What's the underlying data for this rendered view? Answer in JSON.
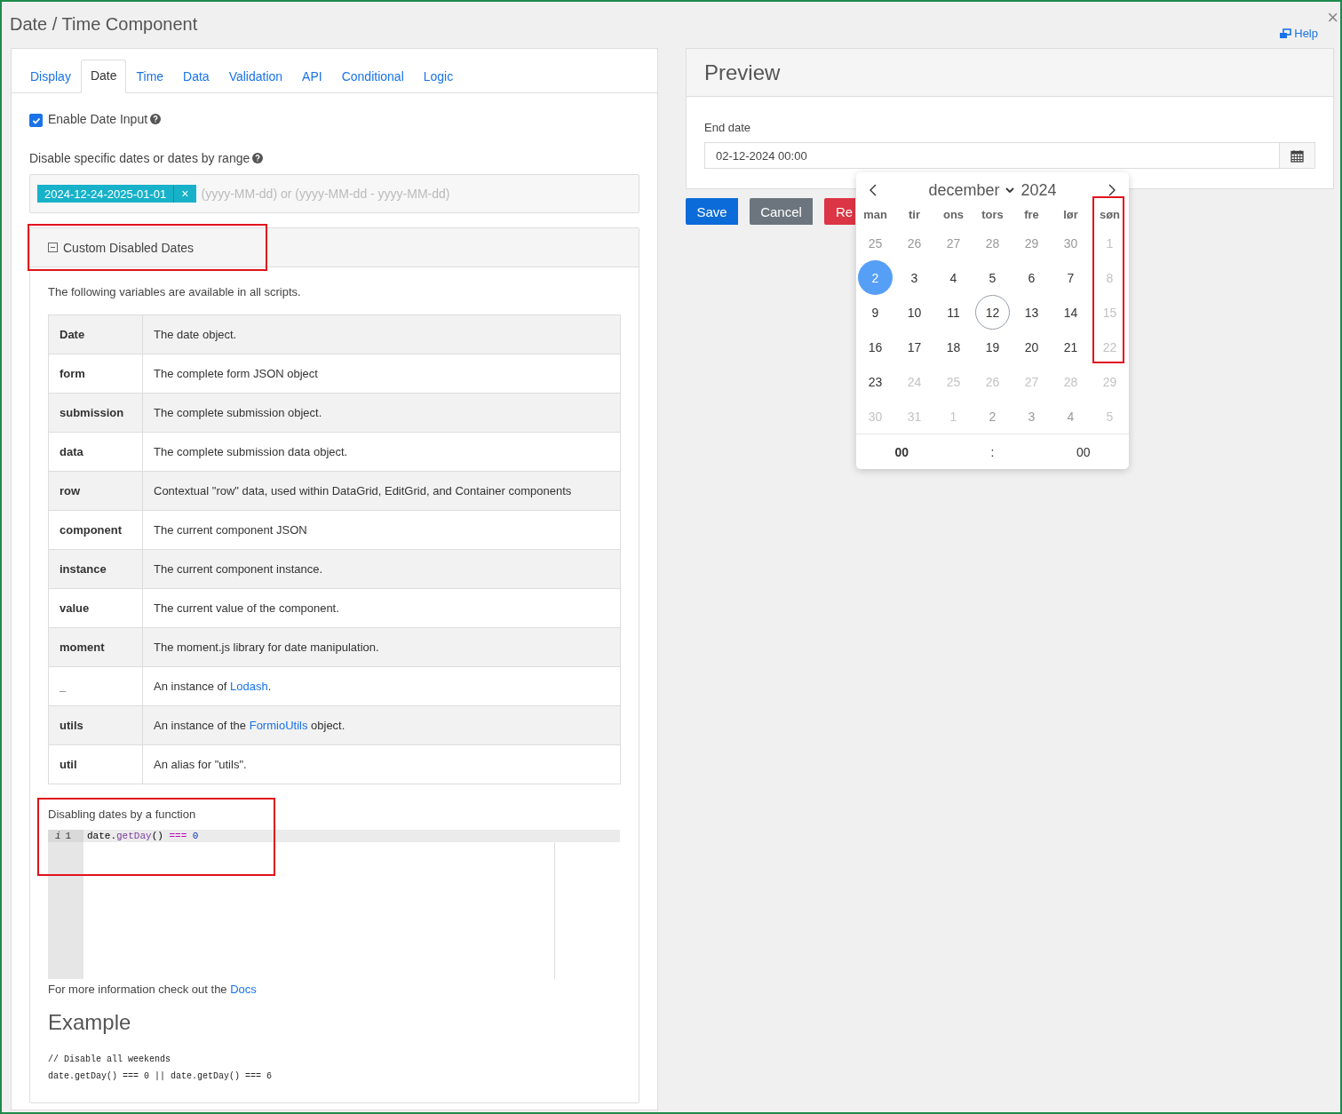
{
  "window": {
    "title": "Date / Time Component",
    "help_link": "Help",
    "close": "×"
  },
  "tabs": [
    {
      "label": "Display",
      "selected": false
    },
    {
      "label": "Date",
      "selected": true
    },
    {
      "label": "Time",
      "selected": false
    },
    {
      "label": "Data",
      "selected": false
    },
    {
      "label": "Validation",
      "selected": false
    },
    {
      "label": "API",
      "selected": false
    },
    {
      "label": "Conditional",
      "selected": false
    },
    {
      "label": "Logic",
      "selected": false
    }
  ],
  "enable_date_input": {
    "label": "Enable Date Input",
    "checked": true
  },
  "disable_dates": {
    "label": "Disable specific dates or dates by range",
    "tags": [
      "2024-12-24-2025-01-01"
    ],
    "tag_remove": "×",
    "placeholder": "(yyyy-MM-dd) or (yyyy-MM-dd - yyyy-MM-dd)"
  },
  "custom_panel": {
    "title": "Custom Disabled Dates",
    "expanded": true,
    "annotated": true,
    "intro": "The following variables are available in all scripts.",
    "variables": [
      {
        "name": "Date",
        "description": "The date object."
      },
      {
        "name": "form",
        "description": "The complete form JSON object"
      },
      {
        "name": "submission",
        "description": "The complete submission object."
      },
      {
        "name": "data",
        "description": "The complete submission data object."
      },
      {
        "name": "row",
        "description": "Contextual \"row\" data, used within DataGrid, EditGrid, and Container components"
      },
      {
        "name": "component",
        "description": "The current component JSON"
      },
      {
        "name": "instance",
        "description": "The current component instance."
      },
      {
        "name": "value",
        "description": "The current value of the component."
      },
      {
        "name": "moment",
        "description": "The moment.js library for date manipulation."
      },
      {
        "name": "_",
        "description": "An instance of ",
        "link": "Lodash",
        "after": "."
      },
      {
        "name": "utils",
        "description": "An instance of the ",
        "link": "FormioUtils",
        "after": " object."
      },
      {
        "name": "util",
        "description": "An alias for \"utils\"."
      }
    ],
    "function_editor": {
      "label": "Disabling dates by a function",
      "annotated": true,
      "lines": [
        {
          "marker": "i",
          "number": "1",
          "tokens": [
            {
              "text": "date.",
              "kind": "plain"
            },
            {
              "text": "getDay",
              "kind": "method"
            },
            {
              "text": "()",
              "kind": "plain"
            },
            {
              "text": " === ",
              "kind": "operator"
            },
            {
              "text": "0",
              "kind": "number"
            }
          ]
        }
      ]
    },
    "docs": {
      "text": "For more information check out the ",
      "link": "Docs"
    },
    "example": {
      "title": "Example",
      "code": [
        "// Disable all weekends",
        "date.getDay() === 0 || date.getDay() === 6"
      ]
    }
  },
  "preview": {
    "title": "Preview",
    "field_label": "End date",
    "value": "02-12-2024 00:00",
    "buttons": [
      {
        "label": "Save",
        "kind": "primary"
      },
      {
        "label": "Cancel",
        "kind": "secondary"
      },
      {
        "label": "Re",
        "kind": "danger"
      }
    ]
  },
  "calendar": {
    "month": "december",
    "year": "2024",
    "weekdays": [
      {
        "label": "man",
        "annotated": false
      },
      {
        "label": "tir",
        "annotated": false
      },
      {
        "label": "ons",
        "annotated": false
      },
      {
        "label": "tors",
        "annotated": false
      },
      {
        "label": "fre",
        "annotated": false
      },
      {
        "label": "lør",
        "annotated": false
      },
      {
        "label": "søn",
        "annotated": true
      }
    ],
    "weeks": [
      [
        {
          "day": "25",
          "outside": true,
          "disabled": false,
          "selected": false,
          "today": false
        },
        {
          "day": "26",
          "outside": true,
          "disabled": false,
          "selected": false,
          "today": false
        },
        {
          "day": "27",
          "outside": true,
          "disabled": false,
          "selected": false,
          "today": false
        },
        {
          "day": "28",
          "outside": true,
          "disabled": false,
          "selected": false,
          "today": false
        },
        {
          "day": "29",
          "outside": true,
          "disabled": false,
          "selected": false,
          "today": false
        },
        {
          "day": "30",
          "outside": true,
          "disabled": false,
          "selected": false,
          "today": false
        },
        {
          "day": "1",
          "outside": false,
          "disabled": true,
          "selected": false,
          "today": false
        }
      ],
      [
        {
          "day": "2",
          "outside": false,
          "disabled": false,
          "selected": true,
          "today": false
        },
        {
          "day": "3",
          "outside": false,
          "disabled": false,
          "selected": false,
          "today": false
        },
        {
          "day": "4",
          "outside": false,
          "disabled": false,
          "selected": false,
          "today": false
        },
        {
          "day": "5",
          "outside": false,
          "disabled": false,
          "selected": false,
          "today": false
        },
        {
          "day": "6",
          "outside": false,
          "disabled": false,
          "selected": false,
          "today": false
        },
        {
          "day": "7",
          "outside": false,
          "disabled": false,
          "selected": false,
          "today": false
        },
        {
          "day": "8",
          "outside": false,
          "disabled": true,
          "selected": false,
          "today": false
        }
      ],
      [
        {
          "day": "9",
          "outside": false,
          "disabled": false,
          "selected": false,
          "today": false
        },
        {
          "day": "10",
          "outside": false,
          "disabled": false,
          "selected": false,
          "today": false
        },
        {
          "day": "11",
          "outside": false,
          "disabled": false,
          "selected": false,
          "today": false
        },
        {
          "day": "12",
          "outside": false,
          "disabled": false,
          "selected": false,
          "today": true
        },
        {
          "day": "13",
          "outside": false,
          "disabled": false,
          "selected": false,
          "today": false
        },
        {
          "day": "14",
          "outside": false,
          "disabled": false,
          "selected": false,
          "today": false
        },
        {
          "day": "15",
          "outside": false,
          "disabled": true,
          "selected": false,
          "today": false
        }
      ],
      [
        {
          "day": "16",
          "outside": false,
          "disabled": false,
          "selected": false,
          "today": false
        },
        {
          "day": "17",
          "outside": false,
          "disabled": false,
          "selected": false,
          "today": false
        },
        {
          "day": "18",
          "outside": false,
          "disabled": false,
          "selected": false,
          "today": false
        },
        {
          "day": "19",
          "outside": false,
          "disabled": false,
          "selected": false,
          "today": false
        },
        {
          "day": "20",
          "outside": false,
          "disabled": false,
          "selected": false,
          "today": false
        },
        {
          "day": "21",
          "outside": false,
          "disabled": false,
          "selected": false,
          "today": false
        },
        {
          "day": "22",
          "outside": false,
          "disabled": true,
          "selected": false,
          "today": false
        }
      ],
      [
        {
          "day": "23",
          "outside": false,
          "disabled": false,
          "selected": false,
          "today": false
        },
        {
          "day": "24",
          "outside": false,
          "disabled": true,
          "selected": false,
          "today": false
        },
        {
          "day": "25",
          "outside": false,
          "disabled": true,
          "selected": false,
          "today": false
        },
        {
          "day": "26",
          "outside": false,
          "disabled": true,
          "selected": false,
          "today": false
        },
        {
          "day": "27",
          "outside": false,
          "disabled": true,
          "selected": false,
          "today": false
        },
        {
          "day": "28",
          "outside": false,
          "disabled": true,
          "selected": false,
          "today": false
        },
        {
          "day": "29",
          "outside": false,
          "disabled": true,
          "selected": false,
          "today": false
        }
      ],
      [
        {
          "day": "30",
          "outside": false,
          "disabled": true,
          "selected": false,
          "today": false
        },
        {
          "day": "31",
          "outside": false,
          "disabled": true,
          "selected": false,
          "today": false
        },
        {
          "day": "1",
          "outside": true,
          "disabled": true,
          "selected": false,
          "today": false
        },
        {
          "day": "2",
          "outside": true,
          "disabled": false,
          "selected": false,
          "today": false
        },
        {
          "day": "3",
          "outside": true,
          "disabled": false,
          "selected": false,
          "today": false
        },
        {
          "day": "4",
          "outside": true,
          "disabled": false,
          "selected": false,
          "today": false
        },
        {
          "day": "5",
          "outside": true,
          "disabled": true,
          "selected": false,
          "today": false
        }
      ]
    ],
    "hours": "00",
    "separator": ":",
    "minutes": "00"
  }
}
